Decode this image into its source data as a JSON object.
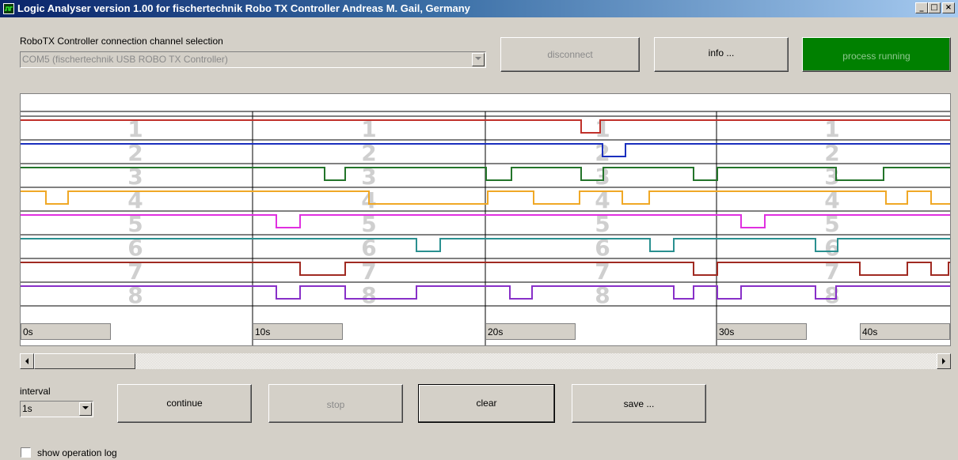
{
  "window": {
    "title": "Logic Analyser   version 1.00   for fischertechnik Robo TX Controller   Andreas M. Gail, Germany",
    "minimize": "_",
    "maximize": "□",
    "close": "×"
  },
  "connection": {
    "label": "RoboTX Controller connection channel selection",
    "selected": "COM5 (fischertechnik USB ROBO TX Controller)"
  },
  "buttons": {
    "disconnect": "disconnect",
    "info": "info ...",
    "process": "process running",
    "continue": "continue",
    "stop": "stop",
    "clear": "clear",
    "save": "save ..."
  },
  "colors": {
    "running": "#008000",
    "ch1": "#c0302a",
    "ch2": "#1a2fbe",
    "ch3": "#23742a",
    "ch4": "#f0a826",
    "ch5": "#e030e0",
    "ch6": "#2a9090",
    "ch7": "#a02a22",
    "ch8": "#8830c8"
  },
  "analyzer": {
    "channels": [
      "1",
      "2",
      "3",
      "4",
      "5",
      "6",
      "7",
      "8"
    ],
    "time_labels": [
      "0s",
      "10s",
      "20s",
      "30s",
      "40s"
    ]
  },
  "interval": {
    "label": "interval",
    "selected": "1s"
  },
  "operation_log": {
    "label": "show operation log",
    "checked": false
  }
}
